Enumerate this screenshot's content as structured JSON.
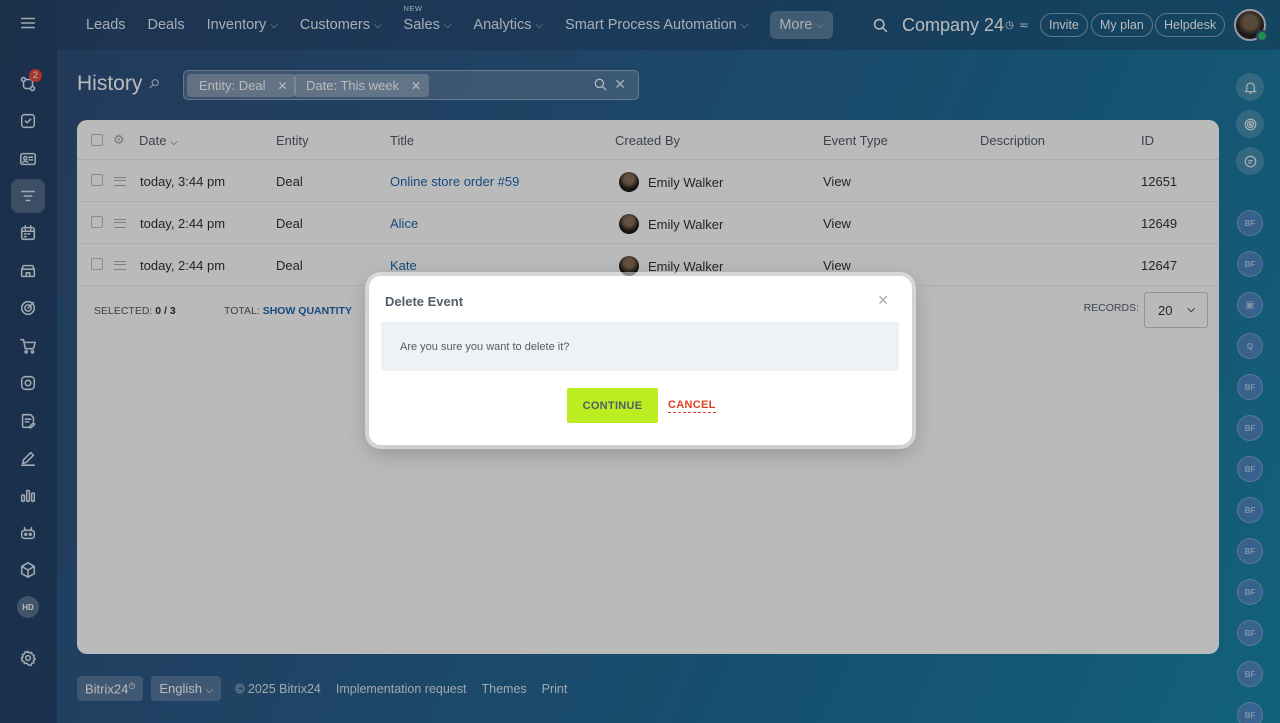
{
  "sidebar": {
    "badge_count": "2",
    "hd_label": "HD"
  },
  "topnav": {
    "items": [
      {
        "label": "Leads"
      },
      {
        "label": "Deals"
      },
      {
        "label": "Inventory"
      },
      {
        "label": "Customers"
      },
      {
        "label": "Sales",
        "tag": "NEW"
      },
      {
        "label": "Analytics"
      },
      {
        "label": "Smart Process Automation"
      },
      {
        "label": "More"
      }
    ],
    "company": "Company 24",
    "invite": "Invite",
    "my_plan": "My plan",
    "helpdesk": "Helpdesk"
  },
  "right_rail": {
    "avatars": [
      "BF",
      "BF",
      "",
      "Q",
      "BF",
      "BF",
      "BF",
      "BF",
      "BF",
      "BF",
      "BF",
      "BF",
      "BF"
    ]
  },
  "page": {
    "title": "History",
    "filters": [
      "Entity: Deal",
      "Date: This week"
    ]
  },
  "table": {
    "columns": [
      "Date",
      "Entity",
      "Title",
      "Created By",
      "Event Type",
      "Description",
      "ID"
    ],
    "rows": [
      {
        "date": "today, 3:44 pm",
        "entity": "Deal",
        "title": "Online store order #59",
        "created_by": "Emily Walker",
        "event_type": "View",
        "description": "",
        "id": "12651"
      },
      {
        "date": "today, 2:44 pm",
        "entity": "Deal",
        "title": "Alice",
        "created_by": "Emily Walker",
        "event_type": "View",
        "description": "",
        "id": "12649"
      },
      {
        "date": "today, 2:44 pm",
        "entity": "Deal",
        "title": "Kate",
        "created_by": "Emily Walker",
        "event_type": "View",
        "description": "",
        "id": "12647"
      }
    ],
    "selected_label": "SELECTED:",
    "selected_value": "0 / 3",
    "total_label": "TOTAL:",
    "total_link": "SHOW QUANTITY",
    "records_label": "RECORDS:",
    "records_value": "20"
  },
  "dialog": {
    "title": "Delete Event",
    "message": "Are you sure you want to delete it?",
    "continue_label": "CONTINUE",
    "cancel_label": "CANCEL"
  },
  "footer": {
    "brand": "Bitrix24",
    "language": "English",
    "copyright": "© 2025 Bitrix24",
    "implementation": "Implementation request",
    "themes": "Themes",
    "print": "Print"
  }
}
